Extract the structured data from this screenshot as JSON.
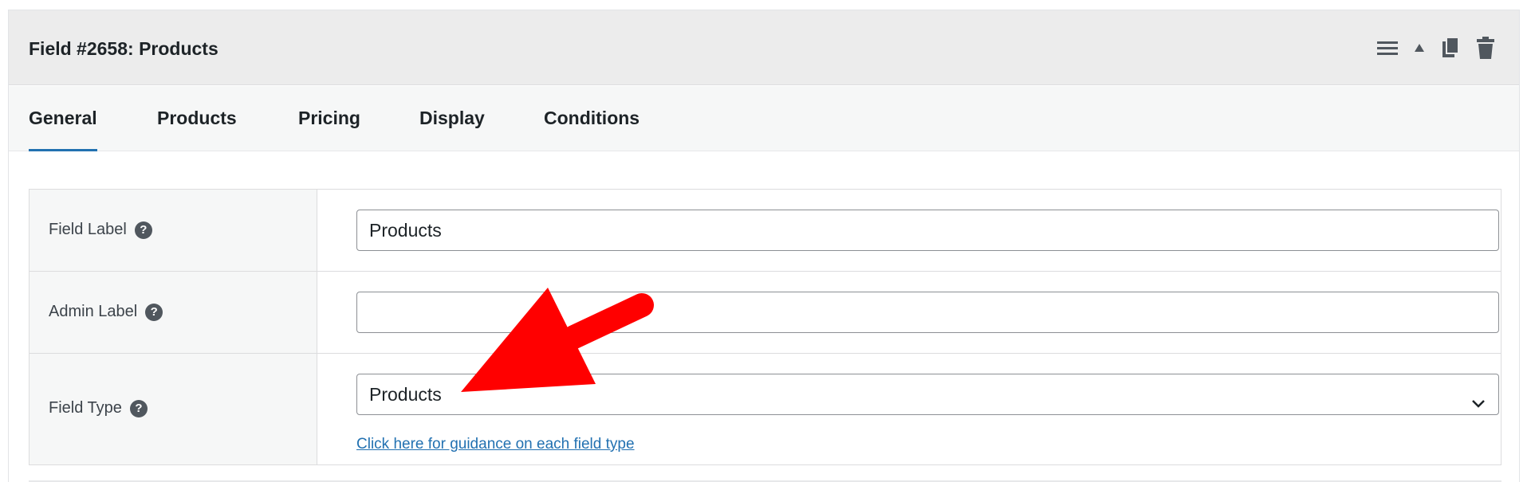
{
  "panel": {
    "title": "Field #2658: Products",
    "actions": [
      "menu-icon",
      "collapse-up-icon",
      "copy-icon",
      "trash-icon"
    ]
  },
  "tabs": [
    {
      "label": "General",
      "active": true
    },
    {
      "label": "Products",
      "active": false
    },
    {
      "label": "Pricing",
      "active": false
    },
    {
      "label": "Display",
      "active": false
    },
    {
      "label": "Conditions",
      "active": false
    }
  ],
  "form": {
    "field_label": {
      "label": "Field Label",
      "value": "Products"
    },
    "admin_label": {
      "label": "Admin Label",
      "value": ""
    },
    "field_type": {
      "label": "Field Type",
      "selected": "Products",
      "guidance_link": "Click here for guidance on each field type"
    },
    "help_glyph": "?"
  },
  "colors": {
    "accent": "#2271b1",
    "annotation_arrow": "#ff0000",
    "header_bg": "#ececec"
  }
}
